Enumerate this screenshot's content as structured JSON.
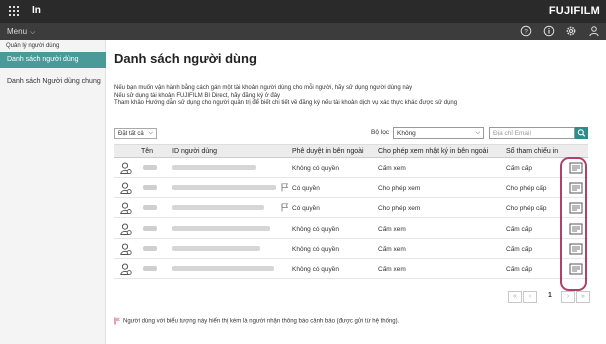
{
  "topbar": {
    "app_name": "In",
    "logo": "FUJIFILM"
  },
  "menubar": {
    "menu_label": "Menu",
    "icons": [
      "help-icon",
      "info-icon",
      "settings-icon",
      "user-icon"
    ]
  },
  "sidebar": {
    "section": "Quản lý người dùng",
    "items": [
      {
        "label": "Danh sách người dùng",
        "active": true
      },
      {
        "label": "Danh sách Người dùng chung",
        "active": false
      }
    ]
  },
  "main": {
    "title": "Danh sách người dùng",
    "description": [
      "Nếu bạn muốn vận hành bằng cách gán một tài khoản người dùng cho mỗi người, hãy sử dụng người dùng này",
      "Nếu sử dụng tài khoản FUJIFILM BI Direct, hãy đăng ký ở đây",
      "Tham khảo Hướng dẫn sử dụng cho người quản trị để biết chi tiết về đăng ký nếu tài khoản dịch vụ xác thực khác được sử dụng"
    ],
    "select_all": "Đặt tất cả",
    "filter_label": "Bộ lọc",
    "filter_value": "Không",
    "email_placeholder": "Địa chỉ Email"
  },
  "table": {
    "columns": [
      "Tên",
      "ID người dùng",
      "Phê duyệt in bên ngoài",
      "Cho phép xem nhật ký in bên ngoài",
      "Sổ tham chiếu in"
    ],
    "rows": [
      {
        "approval": "Không có quyền",
        "log_view": "Cấm xem",
        "reference": "Cấm cấp",
        "flag": false
      },
      {
        "approval": "Có quyền",
        "log_view": "Cho phép xem",
        "reference": "Cho phép cấp",
        "flag": true
      },
      {
        "approval": "Có quyền",
        "log_view": "Cho phép xem",
        "reference": "Cho phép cấp",
        "flag": true
      },
      {
        "approval": "Không có quyền",
        "log_view": "Cấm xem",
        "reference": "Cấm cấp",
        "flag": false
      },
      {
        "approval": "Không có quyền",
        "log_view": "Cấm xem",
        "reference": "Cấm cấp",
        "flag": false
      },
      {
        "approval": "Không có quyền",
        "log_view": "Cấm xem",
        "reference": "Cấm cấp",
        "flag": false
      }
    ]
  },
  "pager": {
    "current_page": "1"
  },
  "footnote": "Người dùng với biểu tượng này hiển thị kèm là người nhận thông báo cảnh báo (được gửi từ hệ thống).",
  "colors": {
    "accent": "#4a9a9a",
    "highlight": "#b0406a",
    "topbar": "#2a2a2a"
  }
}
